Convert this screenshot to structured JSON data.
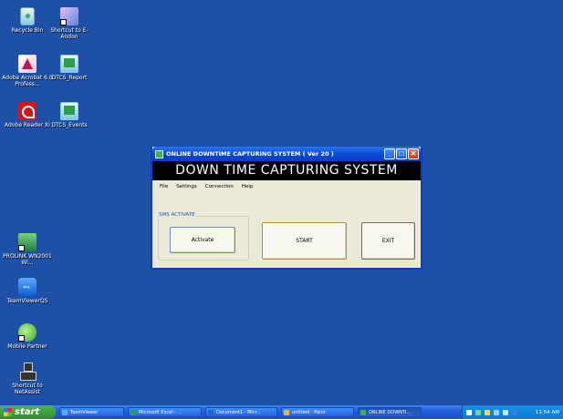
{
  "desktop_icons": [
    {
      "label": "Recycle Bin",
      "icon": "recycle-bin-icon"
    },
    {
      "label": "Shortcut to E-Andon",
      "icon": "eandon-shortcut-icon"
    },
    {
      "label": "Adobe Acrobat 6.0 Profess...",
      "icon": "adobe-acrobat-icon"
    },
    {
      "label": "DTCS_Report",
      "icon": "dtcs-report-icon"
    },
    {
      "label": "Adobe Reader XI",
      "icon": "adobe-reader-icon"
    },
    {
      "label": "DTCS_Events",
      "icon": "dtcs-events-icon"
    },
    {
      "label": "PROLINK WN2001 Wi...",
      "icon": "prolink-icon"
    },
    {
      "label": "TeamViewerQS",
      "icon": "teamviewer-icon"
    },
    {
      "label": "Mobile Partner",
      "icon": "mobile-partner-icon"
    },
    {
      "label": "Shortcut to NetAssist",
      "icon": "netassist-icon"
    }
  ],
  "window": {
    "title": "ONLINE DOWNTIME CAPTURING SYSTEM ( Ver 20 )",
    "banner": "DOWN TIME CAPTURING SYSTEM",
    "menu": [
      "File",
      "Settings",
      "Connection",
      "Help"
    ],
    "group_label": "SMS ACTIVATE",
    "activate_label": "Activate",
    "start_label": "START",
    "exit_label": "EXIT"
  },
  "taskbar": {
    "start_label": "start",
    "tasks": [
      {
        "label": "TeamViewer"
      },
      {
        "label": "Microsoft Excel - ..."
      },
      {
        "label": "Document1 - Micr..."
      },
      {
        "label": "untitled - Paint"
      },
      {
        "label": "ONLINE DOWNTI..."
      }
    ],
    "clock": "11:54 AM"
  }
}
